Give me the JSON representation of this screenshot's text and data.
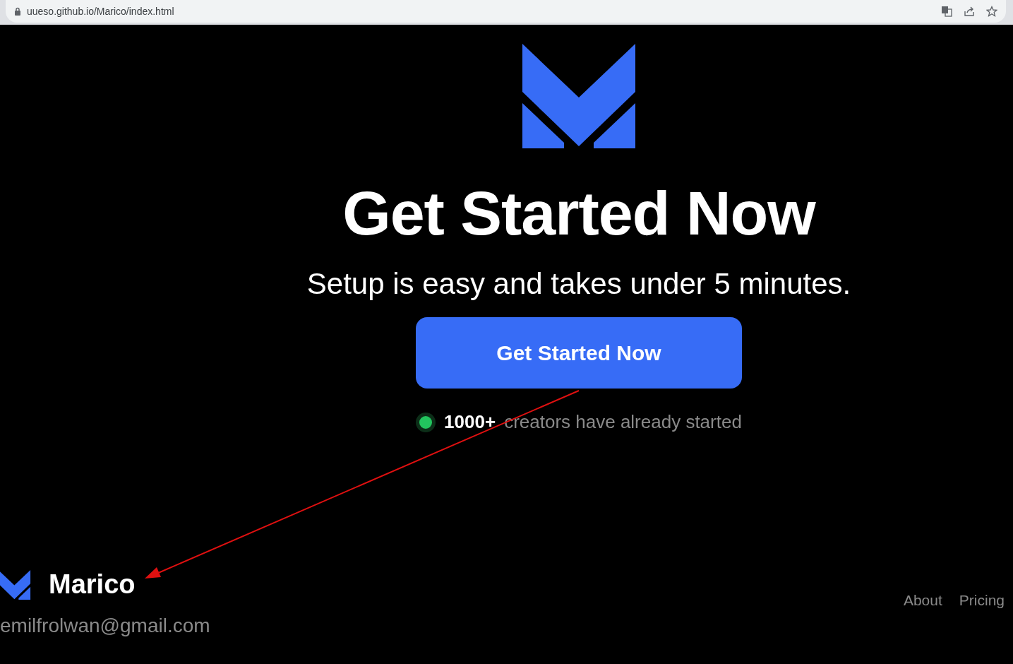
{
  "address_bar": {
    "url": "uueso.github.io/Marico/index.html"
  },
  "hero": {
    "title": "Get Started Now",
    "subtitle": "Setup is easy and takes under 5 minutes.",
    "button": "Get Started Now",
    "social_proof": {
      "count": "1000+",
      "text": "creators have already started"
    }
  },
  "footer": {
    "brand": "Marico",
    "email": "emilfrolwan@gmail.com",
    "links": [
      "About",
      "Pricing"
    ]
  }
}
